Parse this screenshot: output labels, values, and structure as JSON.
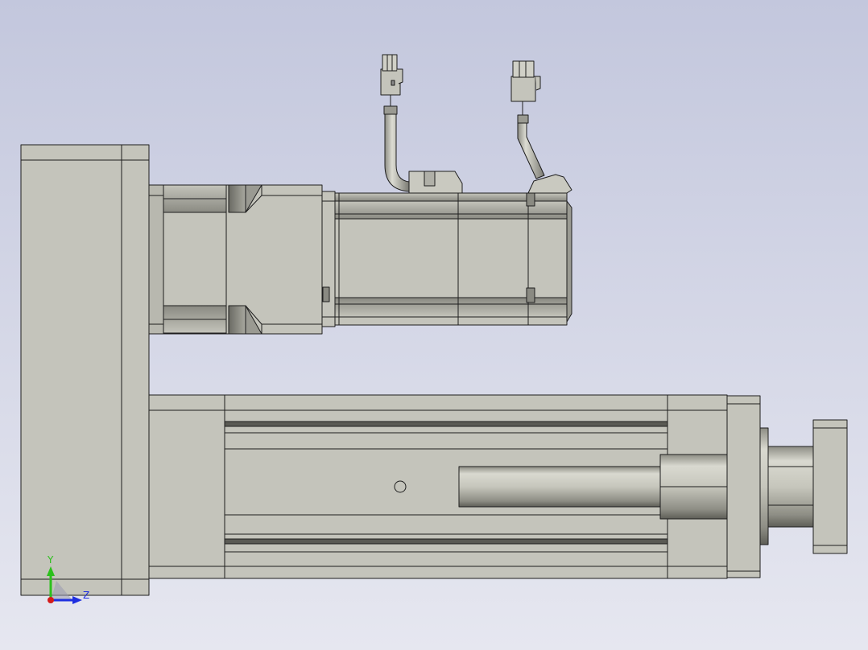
{
  "viewport": {
    "background_top": "#c3c7dd",
    "background_bottom": "#e6e7f0",
    "part_color": "#c4c4bb",
    "edge_color": "#1e1e1e"
  },
  "triad": {
    "y_label": "Y",
    "z_label": "Z",
    "y_color": "#2cc01c",
    "z_color": "#1f2fe0",
    "x_color": "#d41a1a"
  },
  "model": {
    "parts": [
      "base-plate",
      "gearbox",
      "servo-motor",
      "motor-cable",
      "encoder-cable",
      "actuator-body",
      "actuator-rod",
      "rod-end-flange"
    ]
  }
}
